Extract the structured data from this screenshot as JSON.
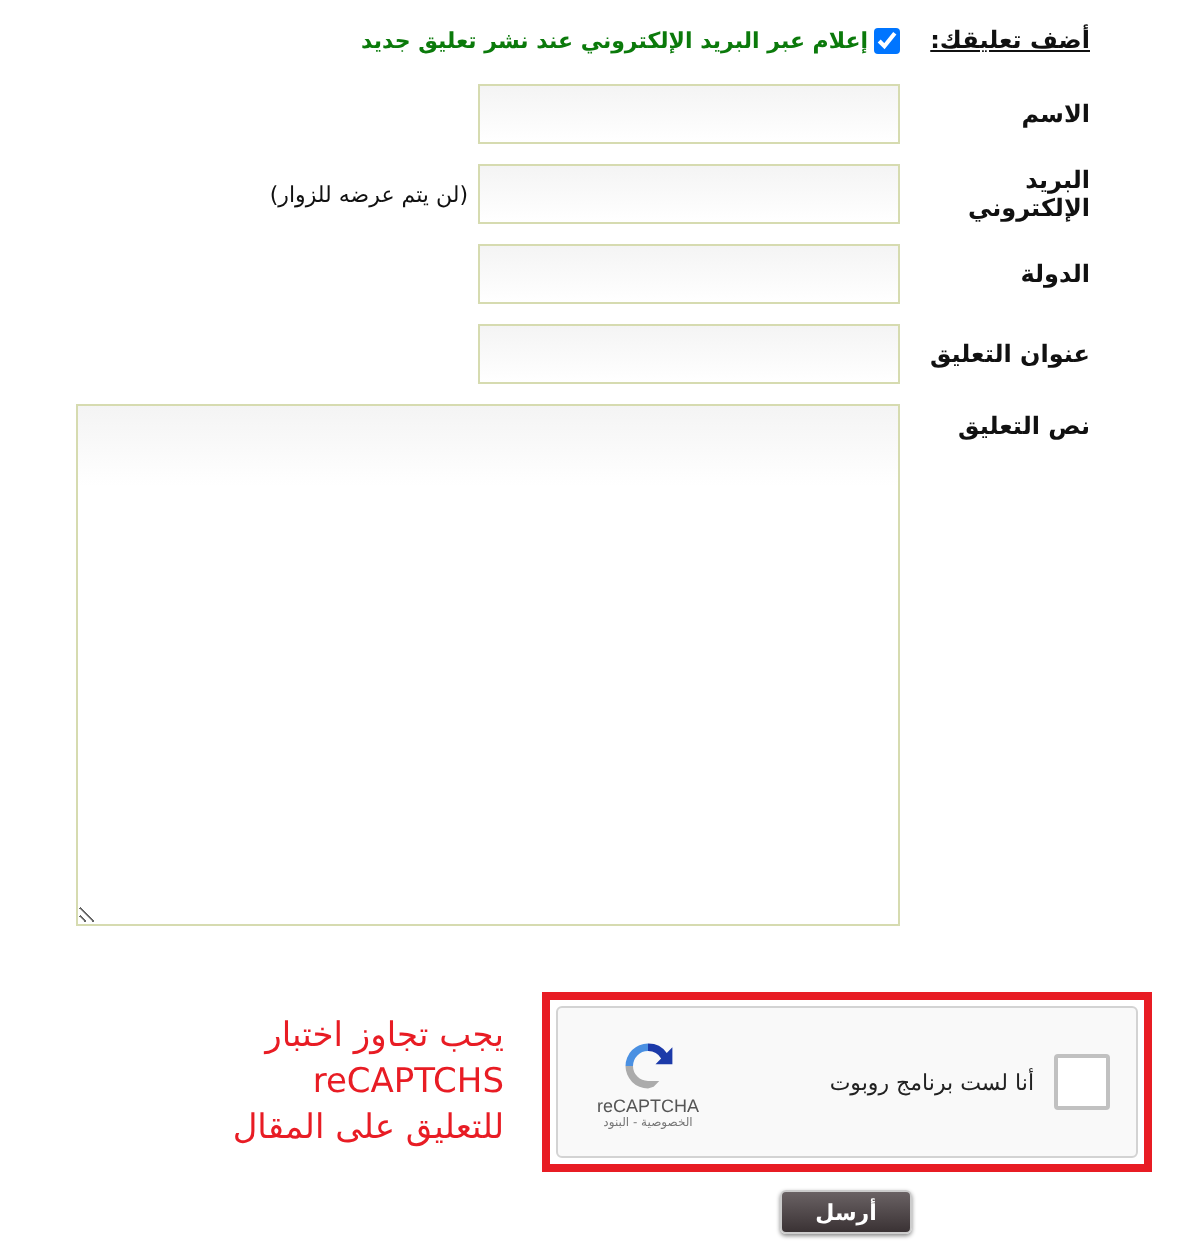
{
  "form": {
    "heading": "أضف تعليقك:",
    "notify": {
      "label": "إعلام عبر البريد الإلكتروني عند نشر تعليق جديد",
      "checked": true
    },
    "fields": [
      {
        "label": "الاسم",
        "kind": "input"
      },
      {
        "label": "البريد الإلكتروني",
        "kind": "input",
        "note": "(لن يتم عرضه للزوار)"
      },
      {
        "label": "الدولة",
        "kind": "input"
      },
      {
        "label": "عنوان التعليق",
        "kind": "input"
      },
      {
        "label": "نص التعليق",
        "kind": "textarea"
      }
    ]
  },
  "captcha": {
    "warning": [
      "يجب تجاوز اختبار",
      "reCAPTCHS",
      "للتعليق على المقال"
    ],
    "label": "أنا لست برنامج روبوت",
    "checked": false,
    "brand": "reCAPTCHA",
    "links": "الخصوصية - البنود"
  },
  "submit": "أرسل"
}
